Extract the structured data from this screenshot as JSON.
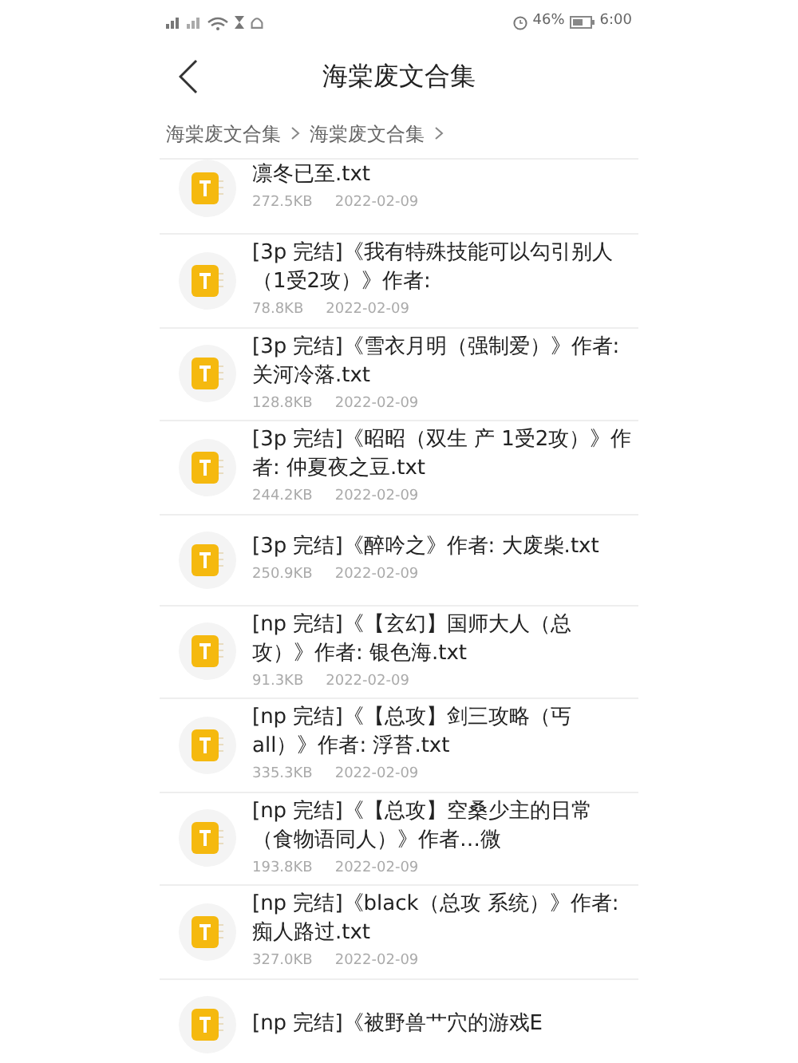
{
  "status_bar": {
    "battery": "46%",
    "time": "6:00"
  },
  "header": {
    "title": "海棠废文合集"
  },
  "breadcrumb": [
    {
      "label": "海棠废文合集"
    },
    {
      "label": "海棠废文合集"
    }
  ],
  "files": [
    {
      "name": "凛冬已至.txt",
      "size": "272.5KB",
      "date": "2022-02-09"
    },
    {
      "name": "[3p 完结]《我有特殊技能可以勾引别人（1受2攻）》作者:",
      "size": "78.8KB",
      "date": "2022-02-09"
    },
    {
      "name": "[3p 完结]《雪衣月明（强制爱）》作者: 关河冷落.txt",
      "size": "128.8KB",
      "date": "2022-02-09"
    },
    {
      "name": "[3p 完结]《昭昭（双生 产 1受2攻）》作者: 仲夏夜之豆.txt",
      "size": "244.2KB",
      "date": "2022-02-09"
    },
    {
      "name": "[3p 完结]《醉吟之》作者: 大废柴.txt",
      "size": "250.9KB",
      "date": "2022-02-09"
    },
    {
      "name": "[np 完结]《【玄幻】国师大人（总攻）》作者: 银色海.txt",
      "size": "91.3KB",
      "date": "2022-02-09"
    },
    {
      "name": "[np 完结]《【总攻】剑三攻略（丐all）》作者: 浮苔.txt",
      "size": "335.3KB",
      "date": "2022-02-09"
    },
    {
      "name": "[np 完结]《【总攻】空桑少主的日常（食物语同人）》作者…微",
      "size": "193.8KB",
      "date": "2022-02-09"
    },
    {
      "name": "[np 完结]《black（总攻 系统）》作者: 痴人路过.txt",
      "size": "327.0KB",
      "date": "2022-02-09"
    },
    {
      "name": "[np 完结]《被野兽艹穴的游戏E"
    }
  ]
}
